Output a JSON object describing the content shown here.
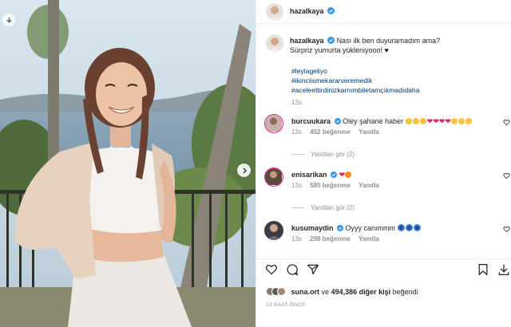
{
  "post": {
    "username": "hazalkaya",
    "caption_line1": "Nası ilk ben duyuramadım ama?",
    "caption_line2": "Sürpriz yumurta yükleniyooo! ♥",
    "hashtags": [
      "#leylageliyo",
      "#ikinciismekararveremedik",
      "#aceleettirdinizkarnımbiletamçıkmadıdaha"
    ],
    "caption_time": "13s"
  },
  "comments": [
    {
      "username": "burcuukara",
      "text": "Oley şahane haber",
      "emojis": [
        "clap",
        "clap",
        "clap",
        "heart",
        "heart",
        "heart",
        "heart",
        "smile",
        "smile",
        "smile"
      ],
      "time": "13s",
      "likes": "452 beğenme",
      "reply_label": "Yanıtla",
      "view_replies": "Yanıtları gör (2)"
    },
    {
      "username": "enisarikan",
      "text": "",
      "emojis": [
        "heart",
        "smile"
      ],
      "time": "13s",
      "likes": "585 beğenme",
      "reply_label": "Yanıtla",
      "view_replies": "Yanıtları gör (2)"
    },
    {
      "username": "kusumaydin",
      "text": "Oyyy canımmm",
      "emojis": [
        "eye",
        "eye",
        "eye"
      ],
      "time": "13s",
      "likes": "298 beğenme",
      "reply_label": "Yanıtla",
      "view_replies": ""
    }
  ],
  "likes_bar": {
    "first_liker": "suna.ort",
    "connector": "ve",
    "others": "494,386 diğer kişi",
    "suffix": "beğendi"
  },
  "time_ago": "13 SAAT ÖNCE",
  "colors": {
    "verified": "#3897f0",
    "hashtag": "#00376b",
    "muted": "#8e8e8e"
  },
  "icons": [
    "download-icon",
    "chevron-right-icon",
    "heart-icon",
    "comment-icon",
    "share-icon",
    "bookmark-icon",
    "save-download-icon"
  ]
}
